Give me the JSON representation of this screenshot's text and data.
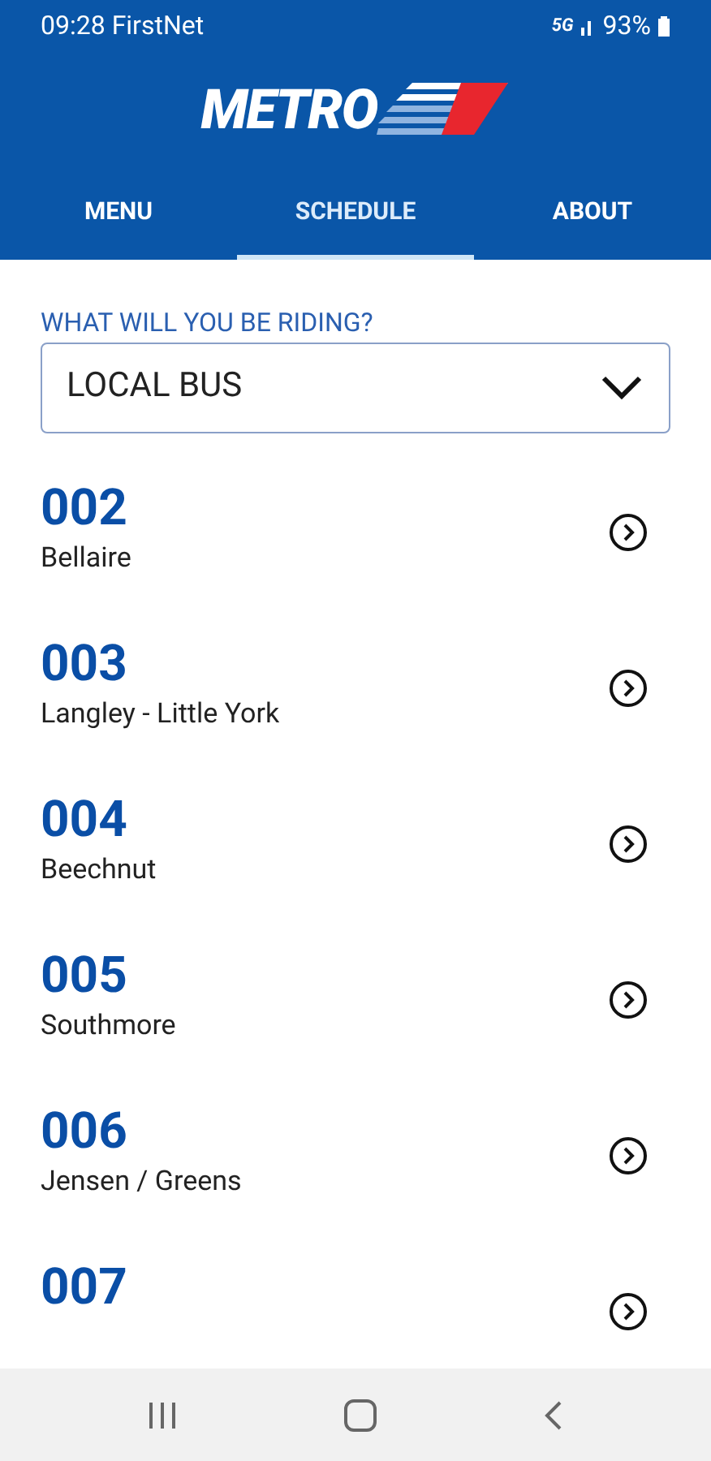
{
  "status_bar": {
    "time_carrier": "09:28 FirstNet",
    "network": "5G",
    "battery": "93%"
  },
  "logo": {
    "text": "METRO"
  },
  "tabs": [
    {
      "label": "MENU",
      "selected": false
    },
    {
      "label": "SCHEDULE",
      "selected": true
    },
    {
      "label": "ABOUT",
      "selected": false
    }
  ],
  "mode_picker": {
    "label": "WHAT WILL YOU BE RIDING?",
    "value": "LOCAL BUS"
  },
  "routes": [
    {
      "number": "002",
      "name": "Bellaire"
    },
    {
      "number": "003",
      "name": "Langley - Little York"
    },
    {
      "number": "004",
      "name": "Beechnut"
    },
    {
      "number": "005",
      "name": "Southmore"
    },
    {
      "number": "006",
      "name": "Jensen / Greens"
    },
    {
      "number": "007"
    }
  ]
}
